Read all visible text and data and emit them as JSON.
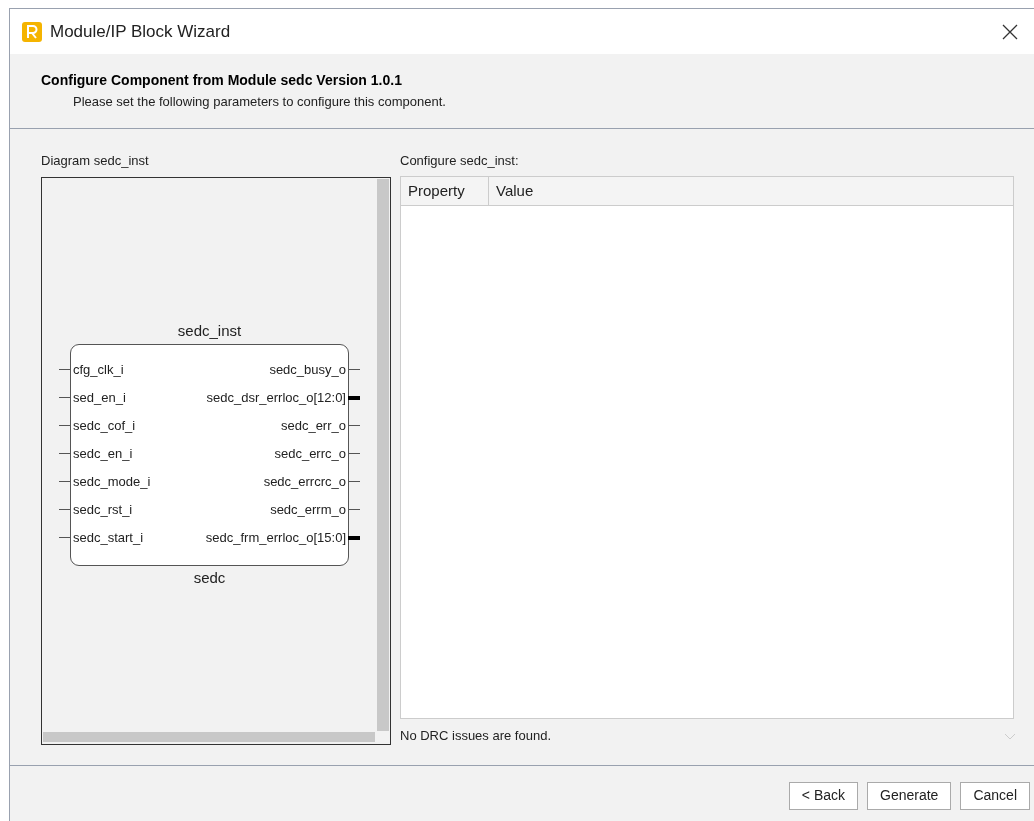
{
  "window": {
    "title": "Module/IP Block Wizard"
  },
  "header": {
    "title": "Configure Component from Module sedc Version 1.0.1",
    "subtitle": "Please set the following parameters to configure this component."
  },
  "diagram": {
    "label": "Diagram sedc_inst",
    "instance": "sedc_inst",
    "module": "sedc",
    "inputs": [
      {
        "name": "cfg_clk_i"
      },
      {
        "name": "sed_en_i"
      },
      {
        "name": "sedc_cof_i"
      },
      {
        "name": "sedc_en_i"
      },
      {
        "name": "sedc_mode_i"
      },
      {
        "name": "sedc_rst_i"
      },
      {
        "name": "sedc_start_i"
      }
    ],
    "outputs": [
      {
        "name": "sedc_busy_o",
        "bus": false
      },
      {
        "name": "sedc_dsr_errloc_o[12:0]",
        "bus": true
      },
      {
        "name": "sedc_err_o",
        "bus": false
      },
      {
        "name": "sedc_errc_o",
        "bus": false
      },
      {
        "name": "sedc_errcrc_o",
        "bus": false
      },
      {
        "name": "sedc_errm_o",
        "bus": false
      },
      {
        "name": "sedc_frm_errloc_o[15:0]",
        "bus": true
      }
    ]
  },
  "configure": {
    "label": "Configure sedc_inst:",
    "columns": [
      "Property",
      "Value"
    ],
    "drc_message": "No DRC issues are found."
  },
  "buttons": [
    "< Back",
    "Generate",
    "Cancel"
  ]
}
